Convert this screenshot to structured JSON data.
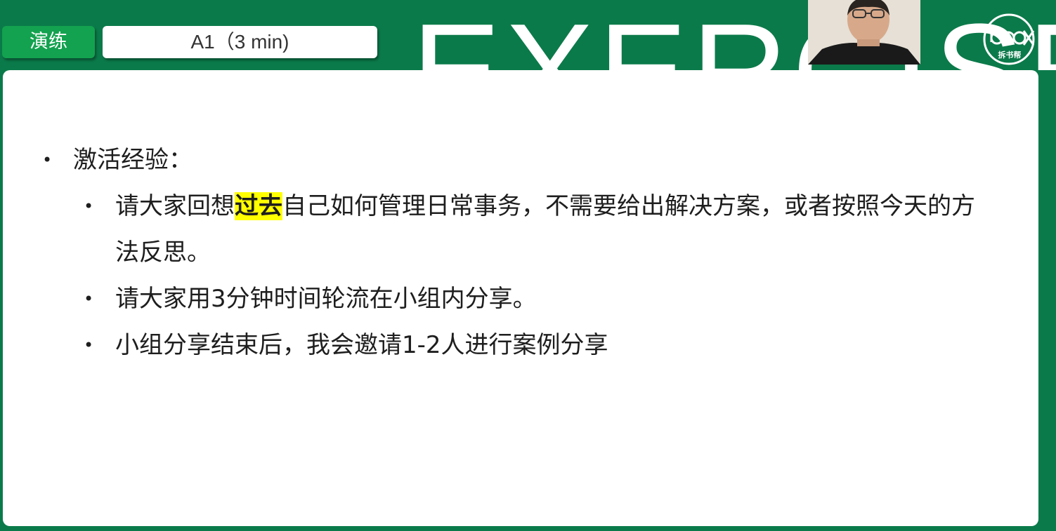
{
  "header": {
    "tag_label": "演练",
    "title": "A1（3 min)",
    "big_word": "EXERCISE",
    "logo_text": "拆书帮",
    "accent_color": "#0b7a4a",
    "tag_color": "#13a24f"
  },
  "content": {
    "heading": "激活经验：",
    "items": [
      {
        "before": "请大家回想",
        "highlight": "过去",
        "after": "自己如何管理日常事务，不需要给出解决方案，或者按照今天的方法反思。"
      },
      {
        "text": "请大家用3分钟时间轮流在小组内分享。"
      },
      {
        "text": "小组分享结束后，我会邀请1-2人进行案例分享"
      }
    ],
    "highlight_color": "#ffff00"
  },
  "icons": {
    "bullet": "•"
  }
}
